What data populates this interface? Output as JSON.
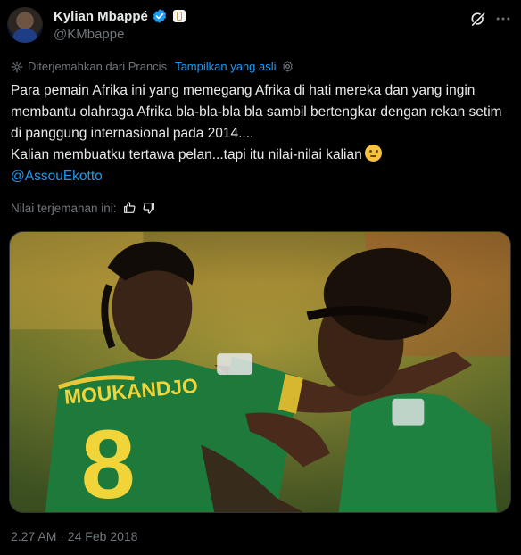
{
  "author": {
    "display_name": "Kylian Mbappé",
    "handle": "@KMbappe",
    "avatar_icon": "avatar-photo",
    "verified_icon": "verified-badge-icon",
    "affiliation_icon": "real-madrid-crest-icon"
  },
  "translation": {
    "notice": "Diterjemahkan dari Prancis",
    "show_original": "Tampilkan yang asli"
  },
  "tweet": {
    "line1": "Para pemain Afrika ini yang memegang Afrika di hati mereka dan yang ingin membantu olahraga Afrika bla-bla-bla bla sambil bertengkar dengan rekan setim di panggung internasional pada 2014....",
    "line2": "Kalian membuatku tertawa pelan...tapi itu nilai-nilai kalian",
    "mention": "@AssouEkotto"
  },
  "rating": {
    "label": "Nilai terjemahan ini:"
  },
  "media": {
    "jersey_name": "MOUKANDJO",
    "jersey_number": "8"
  },
  "timestamp": "2.27 AM · 24 Feb 2018",
  "colors": {
    "background": "#000000",
    "text": "#e7e9ea",
    "muted": "#71767b",
    "link": "#1d9bf0",
    "cameroon_green": "#1e7a3a"
  }
}
